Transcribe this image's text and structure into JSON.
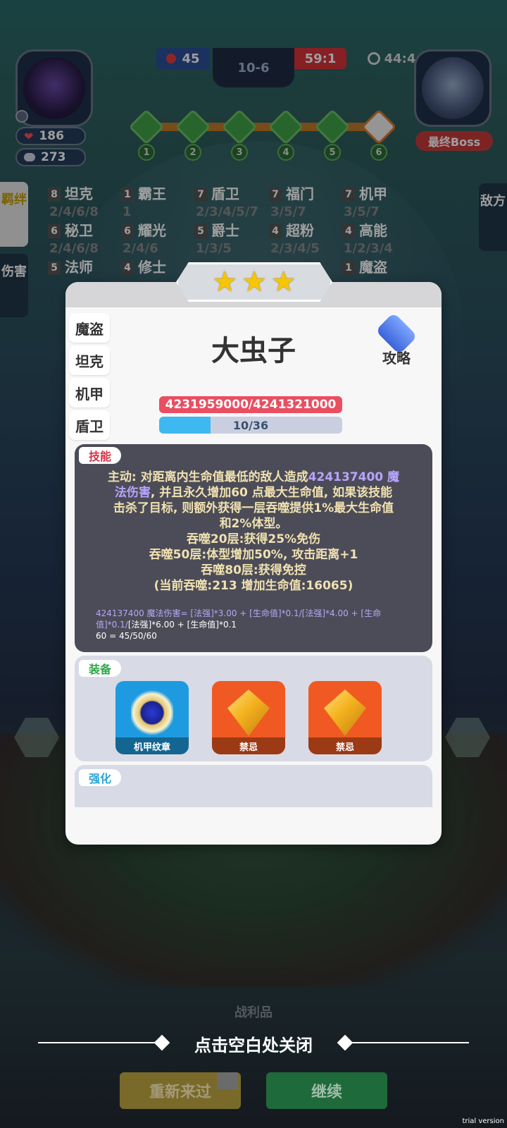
{
  "player": {
    "hp": "186",
    "coins": "273",
    "hp_icon": "heart-icon",
    "coin_icon": "coin-icon"
  },
  "battle": {
    "left_score": "45",
    "level": "10-6",
    "ratio": "59:1",
    "timer": "44:4"
  },
  "stages": [
    "1",
    "2",
    "3",
    "4",
    "5",
    "6"
  ],
  "boss": {
    "label": "最终Boss"
  },
  "side_tabs": {
    "synergy": "羁绊",
    "damage": "伤害",
    "enemy": "敌方"
  },
  "synergies": [
    {
      "count": "8",
      "name": "坦克",
      "levels": "2/4/6/8"
    },
    {
      "count": "1",
      "name": "霸王",
      "levels": "1"
    },
    {
      "count": "7",
      "name": "盾卫",
      "levels": "2/3/4/5/7"
    },
    {
      "count": "7",
      "name": "福门",
      "levels": "3/5/7"
    },
    {
      "count": "7",
      "name": "机甲",
      "levels": "3/5/7"
    },
    {
      "count": "6",
      "name": "秘卫",
      "levels": "2/4/6/8"
    },
    {
      "count": "6",
      "name": "耀光",
      "levels": "2/4/6"
    },
    {
      "count": "5",
      "name": "爵士",
      "levels": "1/3/5"
    },
    {
      "count": "4",
      "name": "超粉",
      "levels": "2/3/4/5"
    },
    {
      "count": "4",
      "name": "高能",
      "levels": "1/2/3/4"
    },
    {
      "count": "5",
      "name": "法师",
      "levels": ""
    },
    {
      "count": "4",
      "name": "修士",
      "levels": ""
    },
    {
      "count": "1",
      "name": "魔盗",
      "levels": ""
    }
  ],
  "card": {
    "stars": 3,
    "hero_name": "大虫子",
    "guide_label": "攻略",
    "class_tabs": [
      "魔盗",
      "坦克",
      "机甲",
      "盾卫"
    ],
    "hp_text": "4231959000/4241321000",
    "exp_text": "10/36",
    "exp_fraction": 0.28,
    "skill_tag": "技能",
    "skill_lines": {
      "l1a": "主动: 对距离内生命值最低的敌人造成",
      "l1b": "424137400 魔",
      "l2a": "法伤害",
      "l2b": ", 并且永久增加60 点最大生命值, 如果该技能",
      "l3": "击杀了目标, 则额外获得一层吞噬提供1%最大生命值",
      "l4": "和2%体型。",
      "l5": "吞噬20层:获得25%免伤",
      "l6": "吞噬50层:体型增加50%, 攻击距离+1",
      "l7": "吞噬80层:获得免控",
      "l8": "(当前吞噬:213 增加生命值:16065)"
    },
    "formula": {
      "f1": "424137400 魔法伤害= [法强]*3.00 + [生命值]*0.1/[法强]*4.00 + [生命",
      "f2a": "值]*0.1/",
      "f2b": "[法强]*6.00 + [生命值]*0.1",
      "f3a": "60 = 45/50/",
      "f3b": "60"
    },
    "equip_tag": "装备",
    "equipment": [
      {
        "name": "机甲纹章",
        "icon": "mech-emblem-icon",
        "color": "#1e9be0"
      },
      {
        "name": "禁忌",
        "icon": "forbidden-gem-icon",
        "color": "#f05a22"
      },
      {
        "name": "禁忌",
        "icon": "forbidden-gem-icon",
        "color": "#f05a22"
      }
    ],
    "enhance_tag": "强化"
  },
  "close_hint": "点击空白处关闭",
  "spoils_label": "战利品",
  "buttons": {
    "retry": "重新来过",
    "continue": "继续"
  },
  "watermark": "trial version",
  "colors": {
    "hp_red": "#ea4e61",
    "exp_blue": "#3db8f0",
    "retry_yellow": "#d9b43a",
    "continue_green": "#2fa153"
  }
}
